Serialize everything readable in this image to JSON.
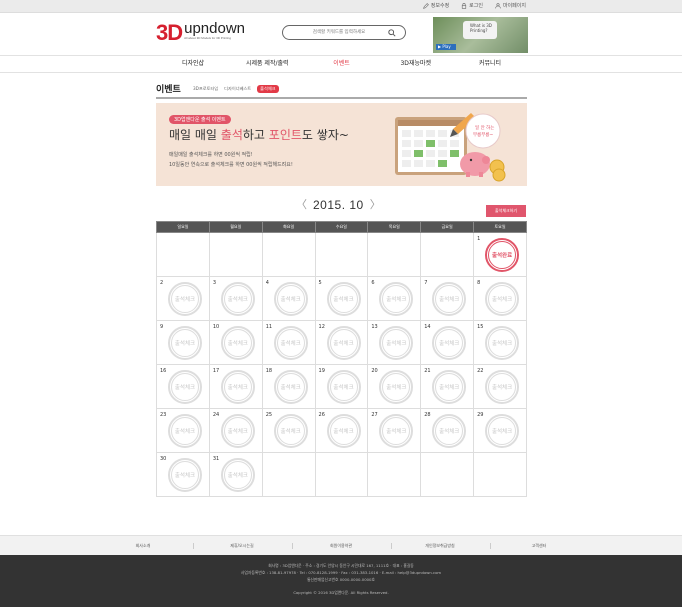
{
  "top_links": [
    "정보수정",
    "로그인",
    "마이페이지"
  ],
  "logo": {
    "mark": "3D",
    "name": "upndown",
    "tagline": "All about 3D Models for 3D Printing"
  },
  "search": {
    "placeholder": "검색할 키워드를 입력하세요"
  },
  "video": {
    "caption": "What is 3D Printing?",
    "play_label": "▶ Play"
  },
  "nav": [
    {
      "label": "디자인샵",
      "active": false
    },
    {
      "label": "시제품 제작/출력",
      "active": false
    },
    {
      "label": "이벤트",
      "active": true
    },
    {
      "label": "3D재능마켓",
      "active": false
    },
    {
      "label": "커뮤니티",
      "active": false
    }
  ],
  "page_title": "이벤트",
  "sub_nav": [
    {
      "label": "3D프로토타입",
      "active": false
    },
    {
      "label": "디자이너베스트",
      "active": false
    },
    {
      "label": "출석체크",
      "active": true
    }
  ],
  "banner": {
    "tag": "3D업앤다운 출석 이벤트",
    "head_a": "매일 매일 ",
    "head_b": "출석",
    "head_c": "하고 ",
    "head_d": "포인트",
    "head_e": "도 쌓자~",
    "desc1": "매일매일 출석체크를 하면 00원씩 적립!",
    "desc2": "10일동안 연속으로 출석체크를 하면 00원씩 적립해드려요!",
    "bubble": "일 안 하는 준비중 부릉부릉~"
  },
  "calendar": {
    "month_title": "2015. 10",
    "prev": "〈",
    "next": "〉",
    "check_button": "출석체크하기",
    "weekdays": [
      "일요일",
      "월요일",
      "화요일",
      "수요일",
      "목요일",
      "금요일",
      "토요일"
    ],
    "stamp_label": "출석체크",
    "done_label": "출석완료",
    "weeks": [
      [
        null,
        null,
        null,
        null,
        null,
        null,
        {
          "day": "1",
          "done": true
        }
      ],
      [
        {
          "day": "2"
        },
        {
          "day": "3"
        },
        {
          "day": "4"
        },
        {
          "day": "5"
        },
        {
          "day": "6"
        },
        {
          "day": "7"
        },
        {
          "day": "8"
        }
      ],
      [
        {
          "day": "9"
        },
        {
          "day": "10"
        },
        {
          "day": "11"
        },
        {
          "day": "12"
        },
        {
          "day": "13"
        },
        {
          "day": "14"
        },
        {
          "day": "15"
        }
      ],
      [
        {
          "day": "16"
        },
        {
          "day": "17"
        },
        {
          "day": "18"
        },
        {
          "day": "19"
        },
        {
          "day": "20"
        },
        {
          "day": "21"
        },
        {
          "day": "22"
        }
      ],
      [
        {
          "day": "23"
        },
        {
          "day": "24"
        },
        {
          "day": "25"
        },
        {
          "day": "26"
        },
        {
          "day": "27"
        },
        {
          "day": "28"
        },
        {
          "day": "29"
        }
      ],
      [
        {
          "day": "30"
        },
        {
          "day": "31"
        },
        null,
        null,
        null,
        null,
        null
      ]
    ]
  },
  "footer_nav": [
    "회사소개",
    "제휴/오시는길",
    "회원이용약관",
    "개인정보취급방침",
    "고객센터"
  ],
  "footer": {
    "line1": "회사명 : 3D업앤다운 · 주소 : 경기도 안양시 동안구 시민대로 167, 1111호 · 대표 : 홍길동",
    "line2": "사업자등록번호 : 138-81-97978 · Tel : 070-8128-1999 · Fax : 031-383-1016 · E-mail : help@3dupndown.com",
    "line3": "통신판매업신고번호 0000-0000-0000호",
    "copyright": "Copyright © 2016 3D업앤다운. All Rights Reserved."
  },
  "colors": {
    "accent": "#e15568",
    "header_gray": "#555555",
    "footer_bg": "#333333"
  }
}
